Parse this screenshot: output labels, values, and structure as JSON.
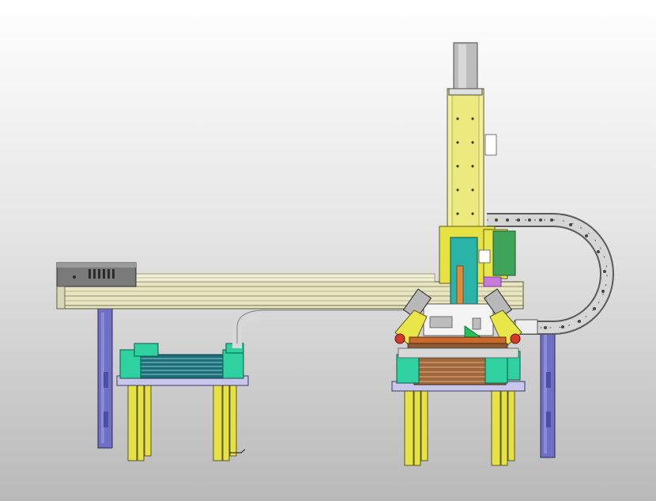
{
  "colors": {
    "background_top": "#ffffff",
    "background_bottom": "#b9b9b9",
    "frame_yellow": "#e9e64a",
    "column_yellow": "#f2f09a",
    "rail_beige": "#e8e6c2",
    "support_blue": "#6f6fc6",
    "plate_lavender": "#c8c6ea",
    "clamp_green": "#2fd1a0",
    "motor_dark": "#707070",
    "chain_grey": "#cfcfcf",
    "gripper_red": "#d23b2a",
    "tray_brown": "#a0673a",
    "accent_magenta": "#c77ad9",
    "accent_orange": "#e08a3c"
  },
  "components": [
    "x-axis-linear-module",
    "x-axis-motor-housing",
    "z-axis-vertical-column",
    "z-axis-servo-motor",
    "cable-drag-chain",
    "gripper-head",
    "left-stacking-station",
    "right-stacking-station",
    "left-gantry-support",
    "right-gantry-support"
  ]
}
